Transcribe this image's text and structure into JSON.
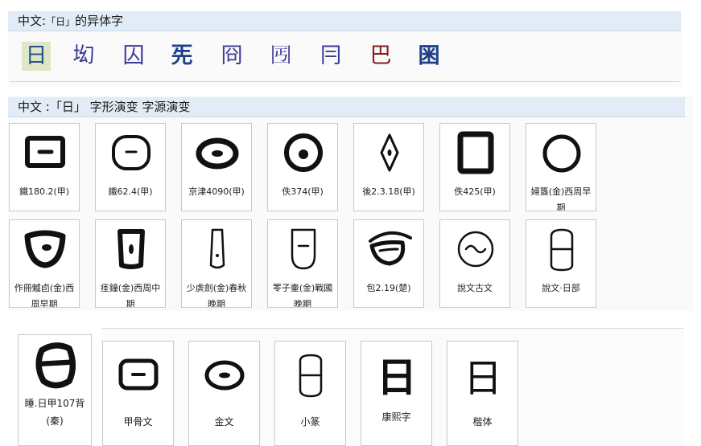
{
  "variants_section": {
    "title_prefix": "中文:",
    "title_char": "「日」",
    "title_suffix": "的异体字",
    "variants": [
      "日",
      "㘭",
      "囚",
      "𠀡",
      "冏",
      "𡆸",
      "冃",
      "巴",
      "𡇒"
    ]
  },
  "evolution_section": {
    "title_prefix": "中文 :",
    "title_char": "「日」",
    "title_suffix": "字形演变 字源演变",
    "row1": [
      {
        "icon": "oracle-bone-square-icon",
        "caption": "鐵180.2(甲)"
      },
      {
        "icon": "oracle-bone-round-icon",
        "caption": "鐵62.4(甲)"
      },
      {
        "icon": "oracle-bone-oval-icon",
        "caption": "京津4090(甲)"
      },
      {
        "icon": "oracle-bone-circle-dot-icon",
        "caption": "佚374(甲)"
      },
      {
        "icon": "oracle-bone-diamond-icon",
        "caption": "後2.3.18(甲)"
      },
      {
        "icon": "oracle-bone-square-bold-icon",
        "caption": "佚425(甲)"
      },
      {
        "icon": "bronze-circle-icon",
        "caption": "婦簋(金)西周早期"
      }
    ],
    "row2": [
      {
        "icon": "bronze-bowl-icon",
        "caption": "作冊魖卣(金)西周早期"
      },
      {
        "icon": "bronze-tall-dot-icon",
        "caption": "㾏鐘(金)西周中期"
      },
      {
        "icon": "bronze-narrow-icon",
        "caption": "少虡劍(金)春秋晚期"
      },
      {
        "icon": "bronze-shield-icon",
        "caption": "𦊓子壷(金)戰國晚期"
      },
      {
        "icon": "chu-eye-icon",
        "caption": "包2.19(楚)"
      },
      {
        "icon": "shuowen-ancient-icon",
        "caption": "說文古文"
      },
      {
        "icon": "shuowen-seal-icon",
        "caption": "說文‧日部"
      }
    ]
  },
  "styles_section": {
    "cards": [
      {
        "icon": "sleep-oracle-icon",
        "caption": "睡.日甲107背(秦)"
      },
      {
        "icon": "oracle-script-icon",
        "caption": "甲骨文"
      },
      {
        "icon": "bronze-script-icon",
        "caption": "金文"
      },
      {
        "icon": "small-seal-icon",
        "caption": "小篆"
      },
      {
        "icon": "kangxi-icon",
        "caption": "康熙字"
      },
      {
        "icon": "regular-script-icon",
        "caption": "楷体"
      }
    ]
  }
}
